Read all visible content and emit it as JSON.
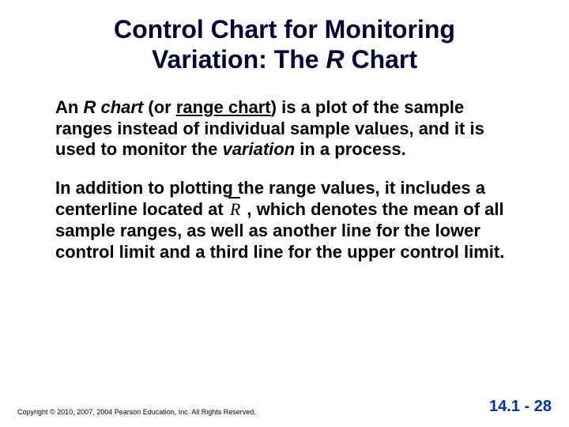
{
  "title": {
    "line1_a": "Control Chart for Monitoring",
    "line2_a": "Variation: The ",
    "line2_italic": "R",
    "line2_b": " Chart"
  },
  "para1": {
    "t1": "An ",
    "t2_italic": "R chart",
    "t3": " (or ",
    "t4_under": "range chart",
    "t5": ") is a plot of the sample ranges instead of individual sample values, and it is used to monitor the ",
    "t6_italic": "variation",
    "t7": " in a process."
  },
  "para2": {
    "t1": "In addition to plotting the range values, it includes a centerline located at ",
    "rbar": "R",
    "t2": " , which denotes the mean of all sample ranges, as well as another line for the lower control limit and a third line for the upper control limit."
  },
  "footer": {
    "copyright": "Copyright © 2010, 2007, 2004 Pearson Education, Inc. All Rights Reserved.",
    "pagenum": "14.1 - 28"
  }
}
